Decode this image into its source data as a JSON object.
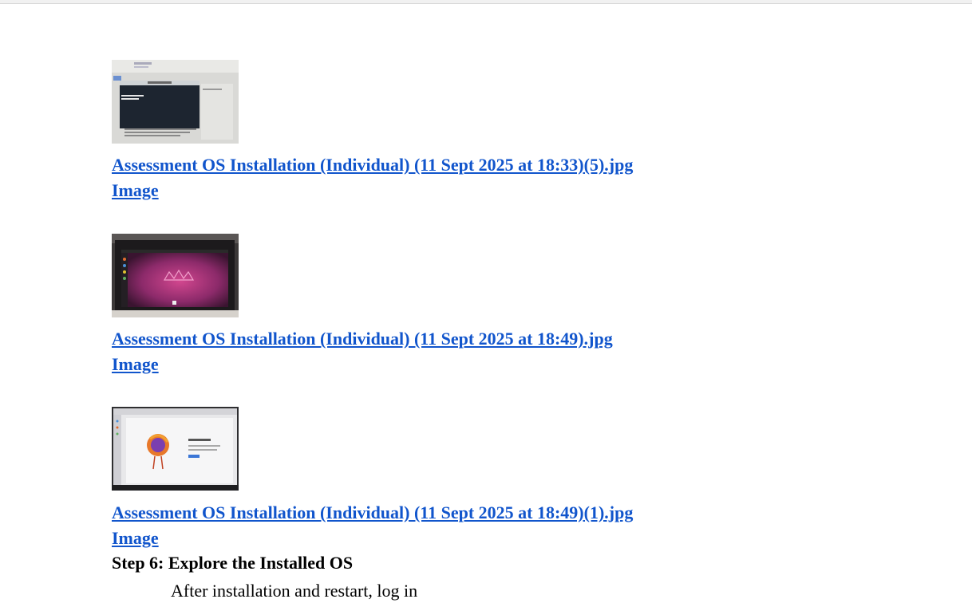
{
  "attachments": [
    {
      "filename": "Assessment OS Installation (Individual) (11 Sept 2025 at 18:33)(5).jpg",
      "type_label": "Image",
      "thumbnail_icon": "terminal-screenshot-thumbnail"
    },
    {
      "filename": "Assessment OS Installation (Individual) (11 Sept 2025 at 18:49).jpg",
      "type_label": "Image",
      "thumbnail_icon": "ubuntu-desktop-photo-thumbnail"
    },
    {
      "filename": "Assessment OS Installation (Individual) (11 Sept 2025 at 18:49)(1).jpg",
      "type_label": "Image",
      "thumbnail_icon": "firefox-welcome-photo-thumbnail"
    }
  ],
  "section": {
    "heading": "Step 6: Explore the Installed OS",
    "body": "After installation and restart, log in"
  }
}
